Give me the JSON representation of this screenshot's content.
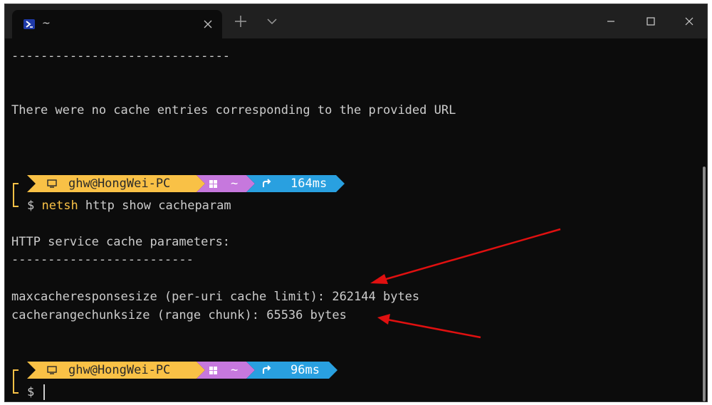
{
  "window": {
    "tab_title": "~",
    "new_tab": "+",
    "dropdown": "⌄",
    "close_tab": "✕"
  },
  "terminal": {
    "separator_top": "------------------------------",
    "no_entries": "There were no cache entries corresponding to the provided URL",
    "prompt1": {
      "user": "ghw@HongWei-PC",
      "dir": "~",
      "time": "164ms",
      "symbol": "$",
      "command": "netsh",
      "args": " http show cacheparam"
    },
    "header": "HTTP service cache parameters:",
    "separator": "-------------------------",
    "param1": "maxcacheresponsesize (per-uri cache limit): 262144 bytes",
    "param2": "cacherangechunksize (range chunk): 65536 bytes",
    "prompt2": {
      "user": "ghw@HongWei-PC",
      "dir": "~",
      "time": "96ms",
      "symbol": "$"
    }
  },
  "colors": {
    "terminal_bg": "#0c0c0c",
    "text": "#cccccc",
    "prompt_user_segment": "#f9c146",
    "prompt_dir_segment": "#c678dd",
    "prompt_time_segment": "#29a0e0",
    "annotation_arrow": "#e01010"
  }
}
